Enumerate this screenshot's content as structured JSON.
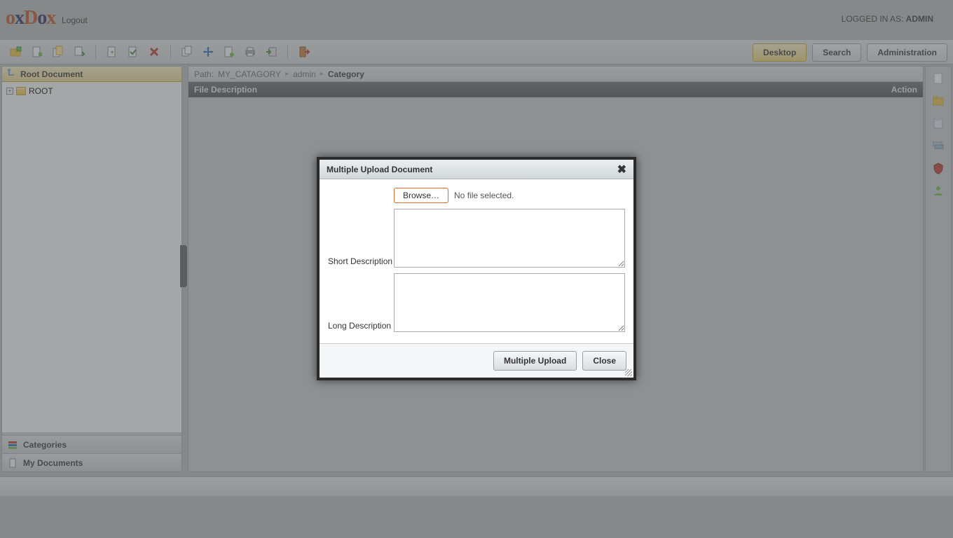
{
  "header": {
    "logo_text_prefix": "ox",
    "logo_text_mid": "D",
    "logo_text_suffix": "ox",
    "logout": "Logout",
    "logged_in_prefix": "LOGGED IN AS: ",
    "logged_in_user": "ADMIN"
  },
  "topnav": {
    "desktop": "Desktop",
    "search": "Search",
    "administration": "Administration"
  },
  "toolbar_icons": [
    "new-folder-icon",
    "new-doc-icon",
    "copy-doc-icon",
    "download-icon",
    "add-page-icon",
    "check-page-icon",
    "delete-icon",
    "copy-icon",
    "move-icon",
    "link-doc-icon",
    "print-icon",
    "import-icon",
    "exit-icon"
  ],
  "sidebar": {
    "title": "Root Document",
    "root_node": "ROOT",
    "categories": "Categories",
    "my_documents": "My Documents"
  },
  "breadcrumb": {
    "prefix": "Path:",
    "seg1": "MY_CATAGORY",
    "seg2": "admin",
    "seg3": "Category"
  },
  "grid": {
    "col_file_description": "File Description",
    "col_action": "Action"
  },
  "right_icons": [
    "page-icon",
    "folder-icon",
    "clipboard-icon",
    "stack-icon",
    "shield-icon",
    "user-icon"
  ],
  "dialog": {
    "title": "Multiple Upload Document",
    "browse": "Browse…",
    "no_file": "No file selected.",
    "short_desc_label": "Short Description",
    "long_desc_label": "Long Description",
    "short_desc_value": "",
    "long_desc_value": "",
    "upload_btn": "Multiple Upload",
    "close_btn": "Close"
  }
}
